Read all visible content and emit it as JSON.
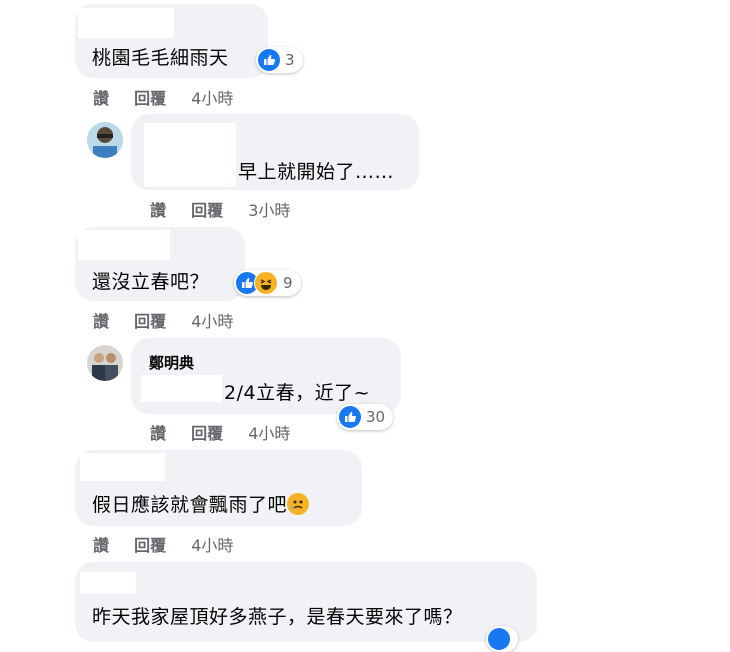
{
  "comments": [
    {
      "text": "桃園毛毛細雨天",
      "reactions": {
        "count": "3"
      },
      "actions": {
        "like": "讚",
        "reply": "回覆",
        "time": "4小時"
      }
    },
    {
      "text": "早上就開始了……",
      "actions": {
        "like": "讚",
        "reply": "回覆",
        "time": "3小時"
      }
    },
    {
      "text": "還沒立春吧？",
      "reactions": {
        "count": "9"
      },
      "actions": {
        "like": "讚",
        "reply": "回覆",
        "time": "4小時"
      }
    },
    {
      "author": "鄭明典",
      "text": "2/4立春，近了~",
      "reactions": {
        "count": "30"
      },
      "actions": {
        "like": "讚",
        "reply": "回覆",
        "time": "4小時"
      }
    },
    {
      "text": "假日應該就會飄雨了吧",
      "emoji": "crying-face-icon",
      "actions": {
        "like": "讚",
        "reply": "回覆",
        "time": "4小時"
      }
    },
    {
      "text": "昨天我家屋頂好多燕子，是春天要來了嗎？"
    }
  ],
  "colors": {
    "bubble": "#f0f2f5",
    "like": "#1877f2",
    "haha": "#f7b125",
    "meta": "#65676b"
  }
}
